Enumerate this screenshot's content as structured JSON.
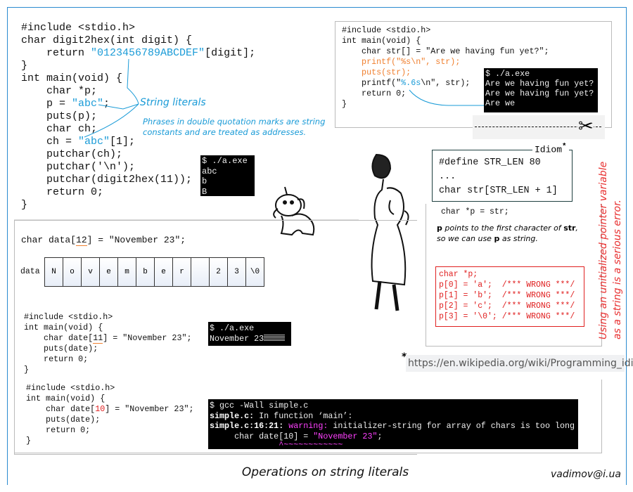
{
  "title": "Operations on string literals",
  "author": "vadimov@i.ua",
  "colors": {
    "accent": "#1a9bd7",
    "error": "#e02020",
    "warning": "#ff40ff",
    "frame": "#2a8bd0"
  },
  "example1": {
    "lines": [
      "#include <stdio.h>",
      "char digit2hex(int digit) {",
      "    return ",
      "}",
      "int main(void) {",
      "    char *p;",
      "    p = ",
      "    puts(p);",
      "    char ch;",
      "    ch = ",
      "    putchar(ch);",
      "    putchar('\\n');",
      "    putchar(digit2hex(11));",
      "    return 0;",
      "}"
    ],
    "literal_hex": "\"0123456789ABCDEF\"",
    "after_hex": "[digit];",
    "literal_abc": "\"abc\"",
    "after_p": ";",
    "after_ch": "[1];",
    "label": "String literals",
    "note_line1": "Phrases in double quotation marks are string",
    "note_line2": "constants and are treated as addresses.",
    "terminal": [
      "$ ./a.exe",
      "abc",
      "b",
      "B"
    ]
  },
  "example2": {
    "lines": [
      "#include <stdio.h>",
      "int main(void) {",
      "    char str[] = \"Are we having fun yet?\";",
      "    printf(\"%s\\n\", str);",
      "    puts(str);",
      "    printf(\"",
      "%.6s",
      "\\n\", str);",
      "    return 0;",
      "}"
    ],
    "terminal": [
      "$ ./a.exe",
      "Are we having fun yet?",
      "Are we having fun yet?",
      "Are we"
    ]
  },
  "idiom": {
    "title": "Idiom",
    "star": "*",
    "lines": [
      "#define STR_LEN 80",
      "...",
      "char str[STR_LEN + 1]"
    ],
    "pointer_line": "char *p = str;",
    "explain": {
      "p": "p",
      "t1": " points to the first character of ",
      "str": "str",
      "t2": ",",
      "t3": "so we can use ",
      "p2": "p",
      "t4": " as string."
    },
    "wrong": [
      "char *p;",
      "p[0] = 'a';  /*** WRONG ***/",
      "p[1] = 'b';  /*** WRONG ***/",
      "p[2] = 'c';  /*** WRONG ***/",
      "p[3] = '\\0'; /*** WRONG ***/"
    ],
    "warning_text": "Using an unitialized pointer variable\nas a string is a serious error.",
    "url_star": "*",
    "url": "https://en.wikipedia.org/wiki/Programming_idiom"
  },
  "array": {
    "decl_pre": "char data[",
    "decl_size": "12",
    "decl_post": "] = \"November 23\";",
    "label": "data",
    "cells": [
      "N",
      "o",
      "v",
      "e",
      "m",
      "b",
      "e",
      "r",
      " ",
      "2",
      "3",
      "\\0"
    ]
  },
  "example3": {
    "lines": [
      "#include <stdio.h>",
      "int main(void) {",
      "    char date[",
      "11",
      "] = \"November 23\";",
      "    puts(date);",
      "    return 0;",
      "}"
    ],
    "terminal": [
      "$ ./a.exe",
      "November 23"
    ]
  },
  "example4": {
    "lines": [
      "#include <stdio.h>",
      "int main(void) {",
      "    char date[",
      "10",
      "] = \"November 23\";",
      "    puts(date);",
      "    return 0;",
      "}"
    ],
    "terminal": {
      "l1": "$ gcc -Wall simple.c",
      "l2a": "simple.c:",
      "l2b": " In function ‘main’:",
      "l3a": "simple.c:16:21:",
      "l3b": " warning:",
      "l3c": " initializer-string for array of chars is too long",
      "l4a": "     char date[10] = ",
      "l4b": "\"November 23\"",
      "l4c": ";",
      "l5": "              ^~~~~~~~~~~~~"
    }
  }
}
